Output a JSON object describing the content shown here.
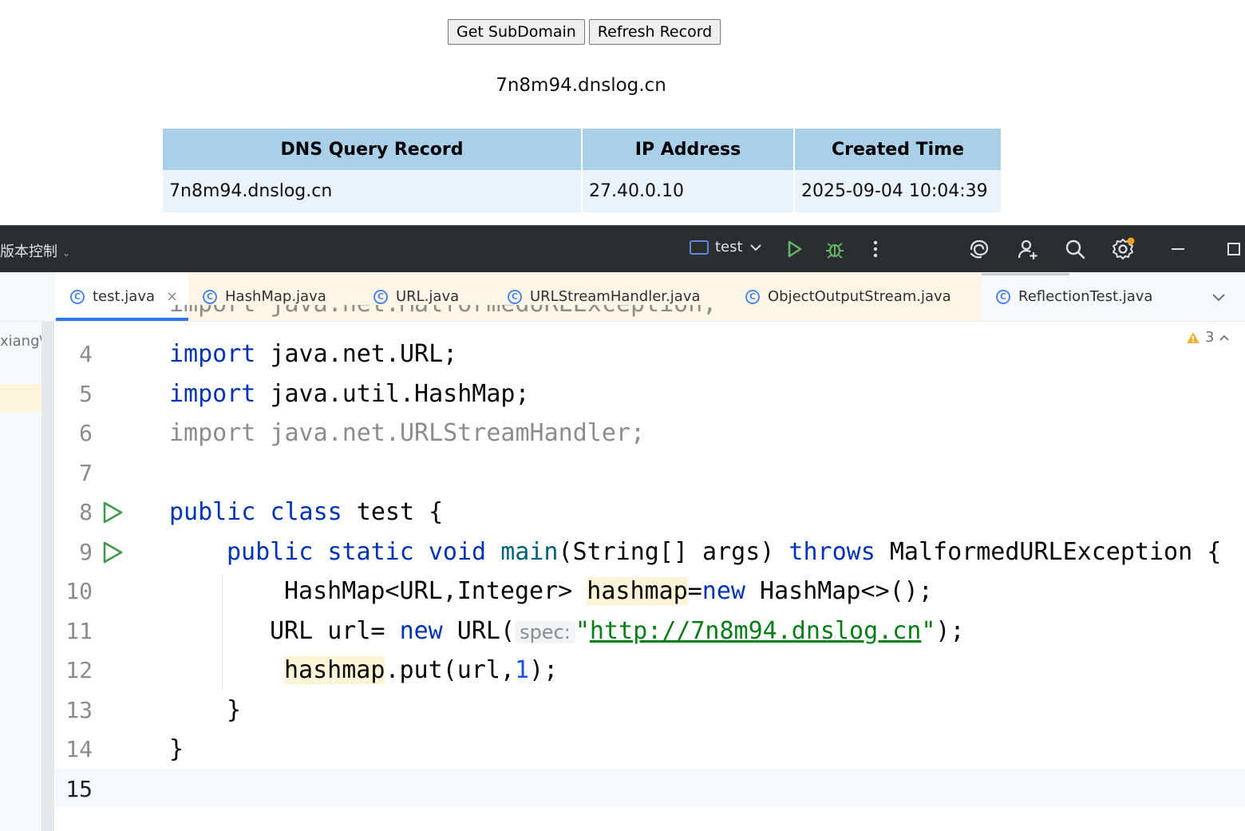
{
  "web": {
    "buttons": {
      "get_subdomain": "Get SubDomain",
      "refresh_record": "Refresh Record"
    },
    "domain": "7n8m94.dnslog.cn",
    "table": {
      "headers": [
        "DNS Query Record",
        "IP Address",
        "Created Time"
      ],
      "rows": [
        [
          "7n8m94.dnslog.cn",
          "27.40.0.10",
          "2025-09-04 10:04:39"
        ]
      ]
    }
  },
  "ide": {
    "vcs_label": "版本控制",
    "run_config": "test",
    "tabs": [
      "test.java",
      "HashMap.java",
      "URL.java",
      "URLStreamHandler.java",
      "ObjectOutputStream.java",
      "ReflectionTest.java"
    ],
    "project_path_fragment": "xiang\\lo",
    "warnings": "3",
    "line_numbers": [
      "4",
      "5",
      "6",
      "7",
      "8",
      "9",
      "10",
      "11",
      "12",
      "13",
      "14",
      "15"
    ],
    "code": {
      "l3": "import java.net.MalformedURLException;",
      "l4_kw": "import",
      "l4_rest": " java.net.URL;",
      "l5_kw": "import",
      "l5_rest": " java.util.HashMap;",
      "l6": "import java.net.URLStreamHandler;",
      "l8_kw1": "public",
      "l8_kw2": "class",
      "l8_rest": " test {",
      "l9_kw1": "public",
      "l9_kw2": "static",
      "l9_kw3": "void",
      "l9_fn": "main",
      "l9_mid": "(String[] args) ",
      "l9_kw4": "throws",
      "l9_rest": " MalformedURLException {",
      "l10_a": "HashMap<URL,Integer> ",
      "l10_var": "hashmap",
      "l10_b": "=",
      "l10_kw": "new",
      "l10_c": " HashMap<>();",
      "l11_a": "URL url= ",
      "l11_kw": "new",
      "l11_b": " URL(",
      "l11_hint": "spec:",
      "l11_q1": "\"",
      "l11_url": "http://7n8m94.dnslog.cn",
      "l11_q2": "\"",
      "l11_c": ");",
      "l12_var": "hashmap",
      "l12_a": ".put(url,",
      "l12_num": "1",
      "l12_b": ");",
      "l13": "}",
      "l14": "}"
    }
  }
}
